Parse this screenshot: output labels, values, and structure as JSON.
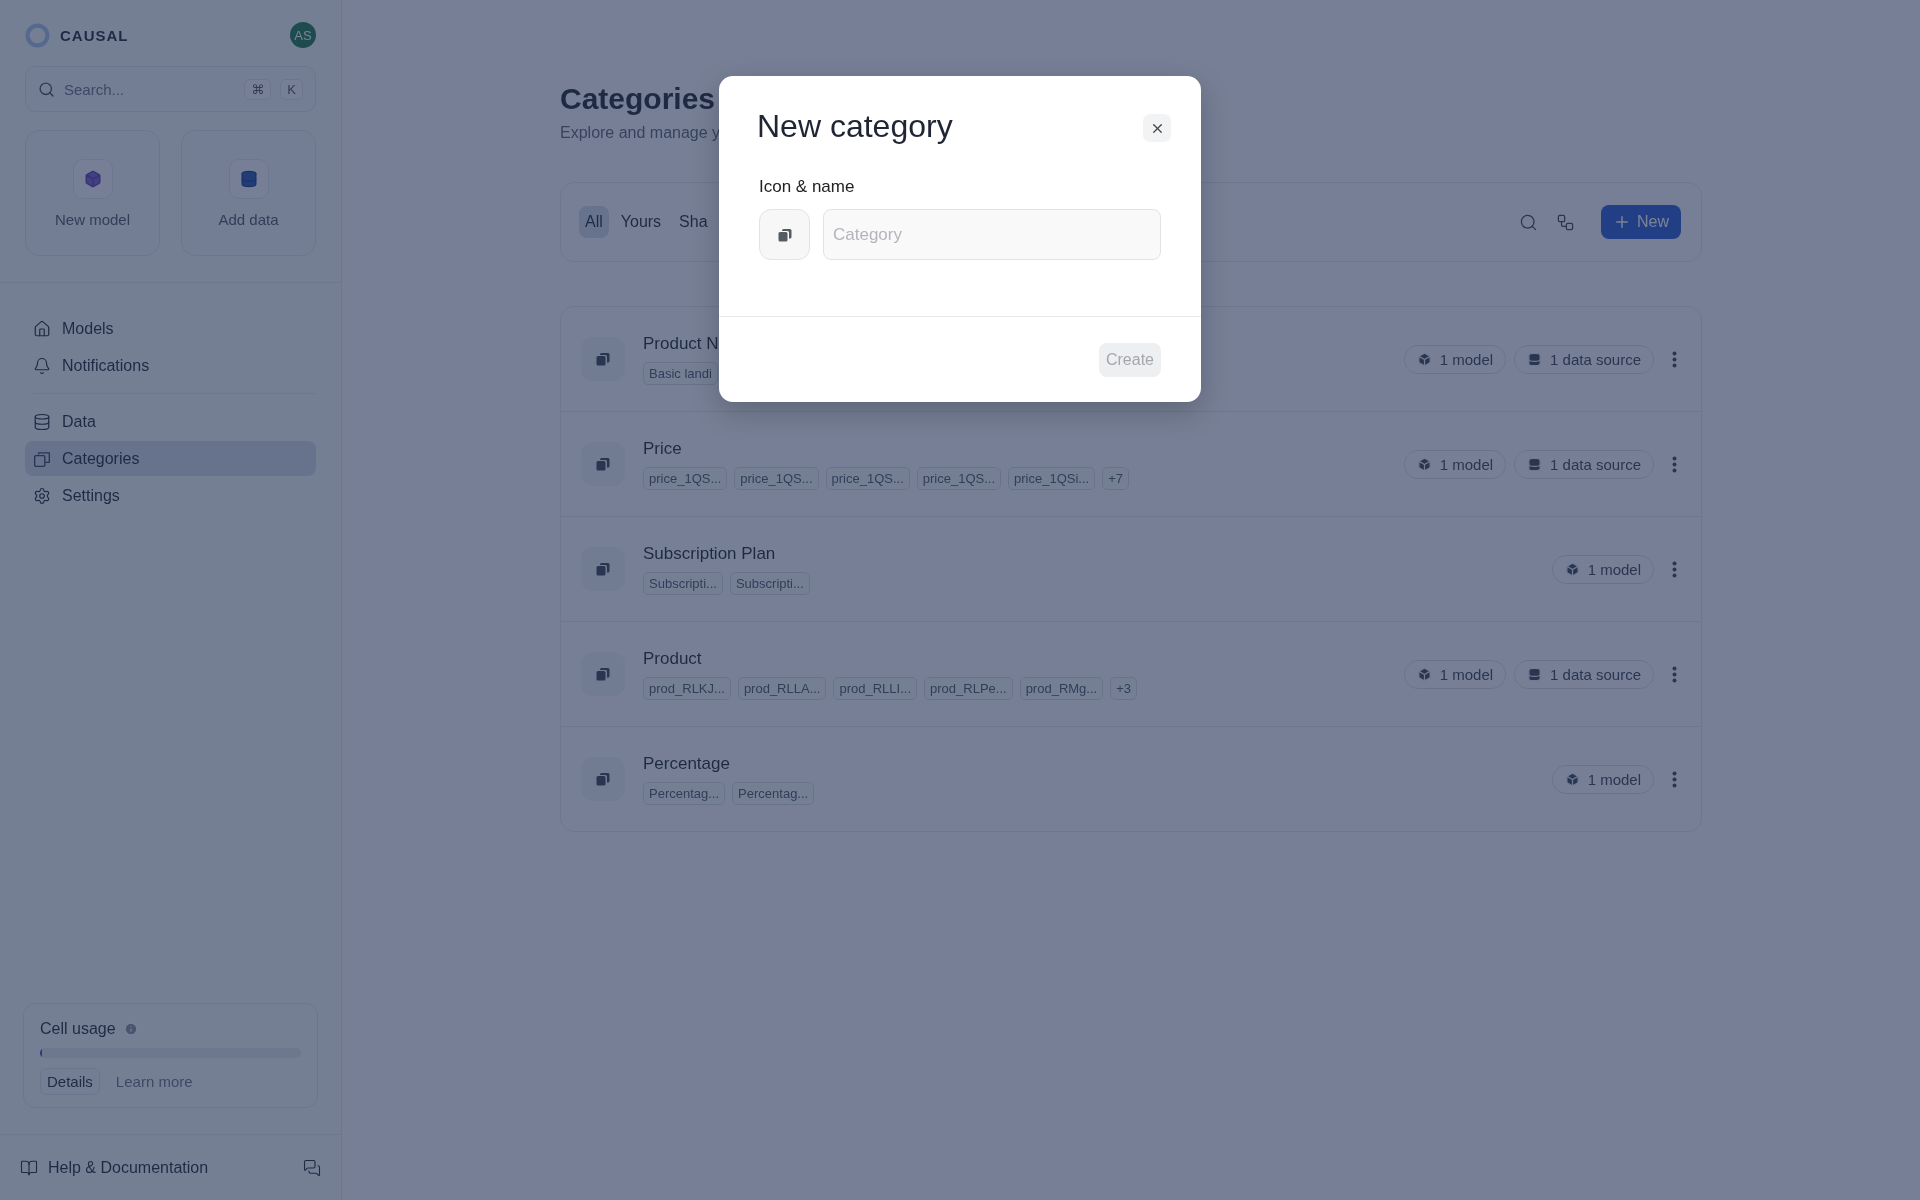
{
  "sidebar": {
    "logo": "CAUSAL",
    "avatar": "AS",
    "search": {
      "placeholder": "Search...",
      "keys": [
        "⌘",
        "K"
      ]
    },
    "actions": [
      {
        "kind": "model",
        "label": "New model"
      },
      {
        "kind": "data",
        "label": "Add data"
      }
    ],
    "nav": [
      {
        "kind": "home",
        "label": "Models",
        "selected": false
      },
      {
        "kind": "bell",
        "label": "Notifications",
        "selected": false
      },
      {
        "kind": "divider"
      },
      {
        "kind": "data",
        "label": "Data",
        "selected": false
      },
      {
        "kind": "categories",
        "label": "Categories",
        "selected": true
      },
      {
        "kind": "settings",
        "label": "Settings",
        "selected": false
      }
    ],
    "usage": {
      "title": "Cell usage",
      "level": 0.005,
      "buttons": [
        "Details",
        "Learn more"
      ]
    },
    "help": "Help & Documentation"
  },
  "page": {
    "title": "Categories",
    "subtitle": "Explore and manage y",
    "filters": [
      {
        "label": "All",
        "selected": true
      },
      {
        "label": "Yours",
        "selected": false
      },
      {
        "label": "Sha",
        "selected": false
      }
    ],
    "new_button": "New",
    "rows": [
      {
        "name": "Product N",
        "tags": [
          "Basic landi"
        ],
        "badges": [
          {
            "kind": "model",
            "label": "1 model"
          },
          {
            "kind": "data",
            "label": "1 data source"
          }
        ]
      },
      {
        "name": "Price",
        "tags": [
          "price_1QS...",
          "price_1QS...",
          "price_1QS...",
          "price_1QS...",
          "price_1QSi..."
        ],
        "more": "+7",
        "badges": [
          {
            "kind": "model",
            "label": "1 model"
          },
          {
            "kind": "data",
            "label": "1 data source"
          }
        ]
      },
      {
        "name": "Subscription Plan",
        "tags": [
          "Subscripti...",
          "Subscripti..."
        ],
        "badges": [
          {
            "kind": "model",
            "label": "1 model"
          }
        ]
      },
      {
        "name": "Product",
        "tags": [
          "prod_RLKJ...",
          "prod_RLLA...",
          "prod_RLLI...",
          "prod_RLPe...",
          "prod_RMg..."
        ],
        "more": "+3",
        "badges": [
          {
            "kind": "model",
            "label": "1 model"
          },
          {
            "kind": "data",
            "label": "1 data source"
          }
        ]
      },
      {
        "name": "Percentage",
        "tags": [
          "Percentag...",
          "Percentag..."
        ],
        "badges": [
          {
            "kind": "model",
            "label": "1 model"
          }
        ]
      }
    ]
  },
  "dialog": {
    "title": "New category",
    "field_label": "Icon & name",
    "placeholder": "Category",
    "create": "Create",
    "create_disabled": true
  }
}
